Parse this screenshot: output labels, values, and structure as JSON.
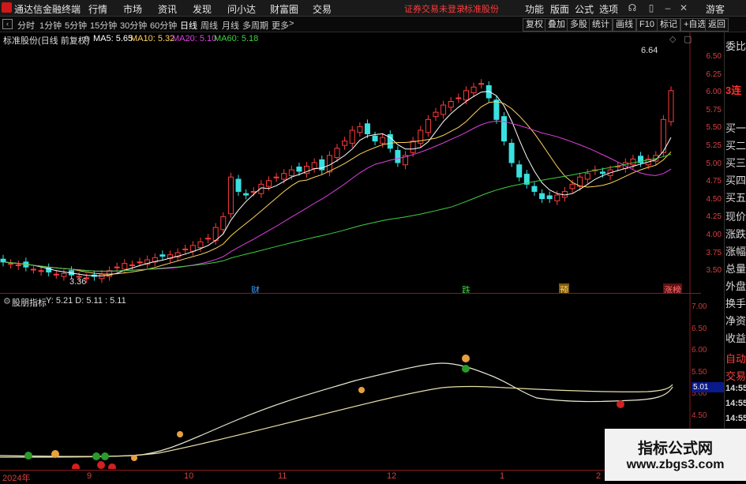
{
  "menubar": {
    "app_title": "通达信金融终端",
    "items": [
      "行情",
      "市场",
      "资讯",
      "发现",
      "问小达",
      "财富圈",
      "交易"
    ],
    "notice": "证券交易未登录",
    "stock_name": "标准股份",
    "right_items": [
      "功能",
      "版面",
      "公式",
      "选项"
    ],
    "user": "游客"
  },
  "periodbar": {
    "periods": [
      "分时",
      "1分钟",
      "5分钟",
      "15分钟",
      "30分钟",
      "60分钟",
      "日线",
      "周线",
      "月线",
      "多周期",
      "更多"
    ],
    "active": "日线",
    "tools": [
      "复权",
      "叠加",
      "多股",
      "统计",
      "画线",
      "F10",
      "标记",
      "+自选",
      "返回"
    ]
  },
  "main_chart": {
    "stock_label": "标准股份(日线 前复权)",
    "ma": [
      {
        "label": "MA5: 5.65",
        "color": "#ffffff"
      },
      {
        "label": "MA10: 5.32",
        "color": "#ffd25a"
      },
      {
        "label": "MA20: 5.10",
        "color": "#e040e0"
      },
      {
        "label": "MA60: 5.18",
        "color": "#40d040"
      }
    ],
    "high_label": "6.64",
    "low_label": "3.36",
    "y_ticks": [
      "6.50",
      "6.25",
      "6.00",
      "5.75",
      "5.50",
      "5.25",
      "5.00",
      "4.75",
      "4.50",
      "4.25",
      "4.00",
      "3.75",
      "3.50"
    ],
    "markers": [
      {
        "text": "财",
        "color": "#3aa0ff"
      },
      {
        "text": "跌",
        "color": "#40d040"
      },
      {
        "text": "预",
        "color": "#e0a020"
      },
      {
        "text": "涨榜",
        "color": "#ff5a5a"
      }
    ]
  },
  "sub_chart": {
    "indicator": "股朋指标",
    "values": "Y: 5.21  D: 5.11  : 5.11",
    "y_ticks": [
      "7.00",
      "6.50",
      "6.00",
      "5.50",
      "5.00",
      "4.50",
      "4.00"
    ],
    "current": "5.01"
  },
  "x_axis": [
    "2024年",
    "9",
    "10",
    "11",
    "12",
    "1",
    "2"
  ],
  "right_panel": {
    "items": [
      "委比",
      "3连",
      "买一",
      "买二",
      "买三",
      "买四",
      "买五",
      "现价",
      "涨跌",
      "涨幅",
      "总量",
      "外盘",
      "换手",
      "净资",
      "收益",
      "自动",
      "交易",
      "14:55",
      "14:55",
      "14:55",
      "14:55",
      "14:55",
      "14:55",
      "14:55",
      "14:55",
      "14:55"
    ]
  },
  "watermark": {
    "line1": "指标公式网",
    "line2": "www.zbgs3.com"
  },
  "chart_data": {
    "type": "candlestick",
    "title": "",
    "y_range": [
      3.3,
      6.7
    ],
    "closes": [
      3.62,
      3.6,
      3.58,
      3.55,
      3.52,
      3.5,
      3.48,
      3.45,
      3.46,
      3.44,
      3.42,
      3.4,
      3.42,
      3.45,
      3.5,
      3.55,
      3.6,
      3.58,
      3.62,
      3.65,
      3.68,
      3.7,
      3.72,
      3.75,
      3.8,
      3.85,
      3.9,
      3.95,
      4.1,
      4.25,
      4.8,
      4.6,
      4.55,
      4.6,
      4.7,
      4.75,
      4.8,
      4.85,
      4.9,
      4.88,
      4.95,
      5.0,
      4.9,
      5.1,
      5.2,
      5.3,
      5.45,
      5.5,
      5.4,
      5.3,
      5.35,
      5.2,
      5.0,
      5.1,
      5.3,
      5.45,
      5.6,
      5.7,
      5.8,
      5.85,
      5.9,
      6.0,
      6.05,
      6.1,
      5.9,
      5.6,
      5.3,
      5.0,
      4.8,
      4.7,
      4.6,
      4.5,
      4.5,
      4.55,
      4.6,
      4.7,
      4.8,
      4.85,
      4.9,
      4.85,
      4.9,
      4.95,
      5.0,
      5.05,
      5.0,
      5.05,
      5.1,
      5.6,
      6.0
    ]
  }
}
